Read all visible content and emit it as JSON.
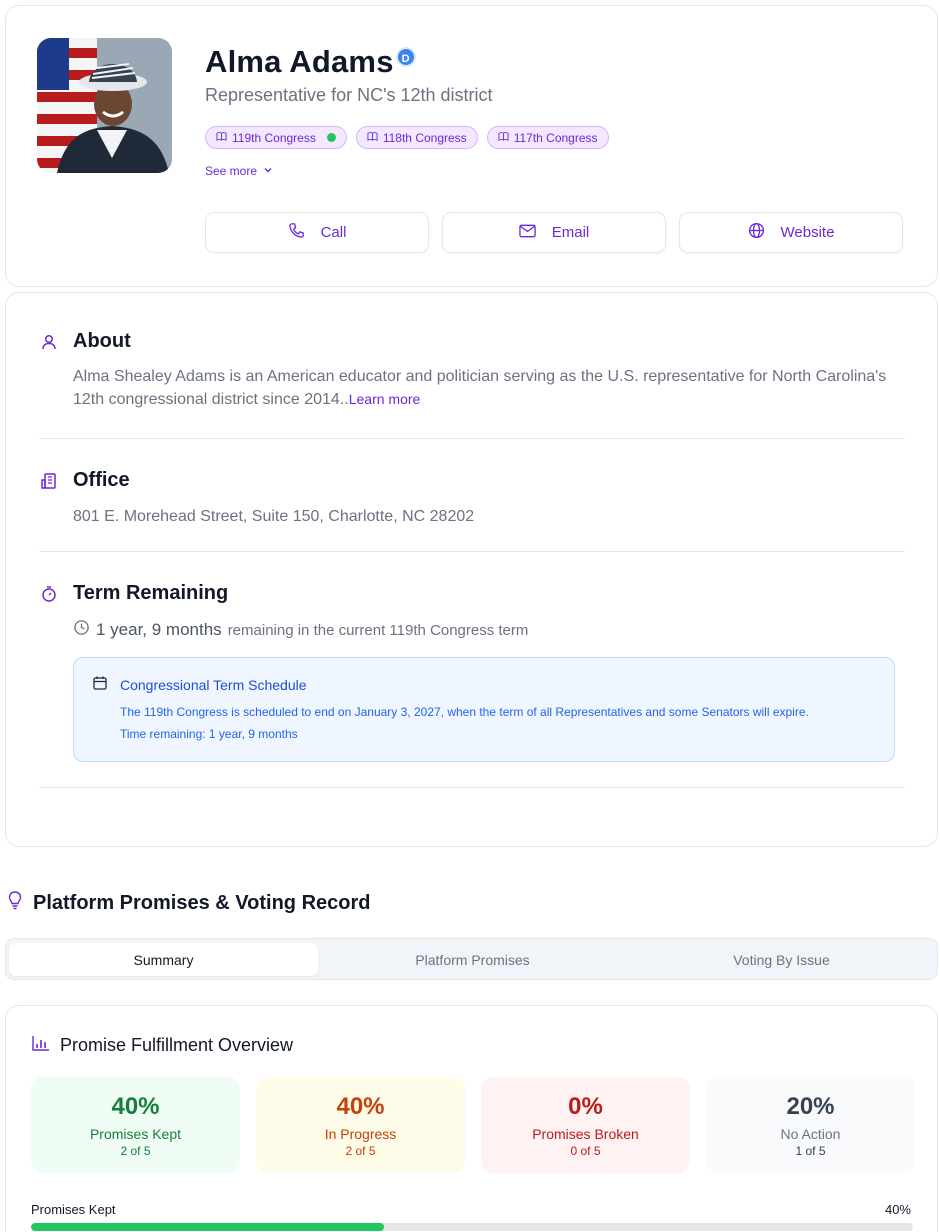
{
  "profile": {
    "name": "Alma Adams",
    "party_badge": "D",
    "role": "Representative for NC's 12th district",
    "congresses": [
      {
        "label": "119th Congress",
        "current": true
      },
      {
        "label": "118th Congress",
        "current": false
      },
      {
        "label": "117th Congress",
        "current": false
      }
    ],
    "see_more": "See more",
    "actions": {
      "call": "Call",
      "email": "Email",
      "website": "Website"
    }
  },
  "about": {
    "title": "About",
    "text": "Alma Shealey Adams is an American educator and politician serving as the U.S. representative for North Carolina's 12th congressional district since 2014..",
    "learn_more": "Learn more"
  },
  "office": {
    "title": "Office",
    "address": "801 E. Morehead Street, Suite 150, Charlotte, NC 28202"
  },
  "term": {
    "title": "Term Remaining",
    "remaining": "1 year, 9 months",
    "suffix": "remaining in the current 119th Congress term",
    "schedule_title": "Congressional Term Schedule",
    "schedule_text": "The 119th Congress is scheduled to end on January 3, 2027, when the term of all Representatives and some Senators will expire.",
    "schedule_remaining": "Time remaining: 1 year, 9 months"
  },
  "platform": {
    "title": "Platform Promises & Voting Record",
    "tabs": [
      "Summary",
      "Platform Promises",
      "Voting By Issue"
    ],
    "active_tab": "Summary"
  },
  "overview": {
    "title": "Promise Fulfillment Overview",
    "stats": [
      {
        "pct": "40%",
        "label": "Promises Kept",
        "sub": "2 of 5",
        "color": "#15803d",
        "bg": "#f0fdf4"
      },
      {
        "pct": "40%",
        "label": "In Progress",
        "sub": "2 of 5",
        "color": "#c2410c",
        "bg": "#fefce8"
      },
      {
        "pct": "0%",
        "label": "Promises Broken",
        "sub": "0 of 5",
        "color": "#b91c1c",
        "bg": "#fef2f2"
      },
      {
        "pct": "20%",
        "label": "No Action",
        "sub": "1 of 5",
        "color": "#374151",
        "bg": "#f8fafc"
      }
    ],
    "progress": {
      "label": "Promises Kept",
      "value_text": "40%",
      "value": 0.4
    }
  },
  "colors": {
    "accent": "#6d28d9",
    "party_blue": "#3b82f6",
    "success": "#22c55e"
  }
}
